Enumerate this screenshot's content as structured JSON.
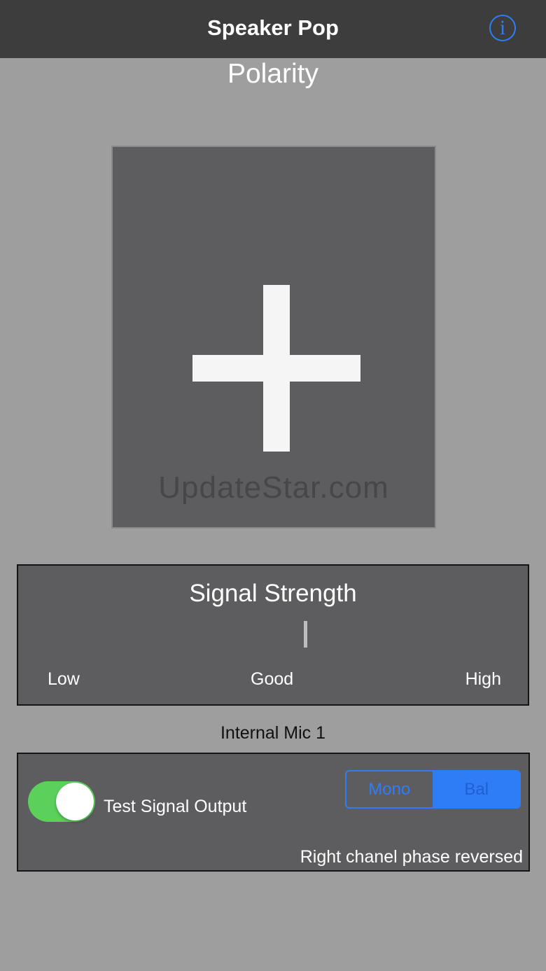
{
  "nav": {
    "title": "Speaker Pop",
    "info_icon": "info-icon",
    "info_glyph": "i"
  },
  "polarity": {
    "title": "Polarity",
    "symbol": "plus-icon"
  },
  "watermark": {
    "text": "UpdateStar.com"
  },
  "signal": {
    "title": "Signal Strength",
    "scale": [
      "Low",
      "Good",
      "High"
    ],
    "level_percent": 56
  },
  "input": {
    "source": "Internal Mic 1"
  },
  "output": {
    "toggle_label": "Test Signal Output",
    "toggle_on": true,
    "segments": [
      "Mono",
      "Bal"
    ],
    "selected_segment": "Bal",
    "status": "Right chanel phase reversed"
  },
  "colors": {
    "accent": "#2f7df6",
    "toggle_on": "#5bd15c",
    "panel": "#5d5d5f",
    "background": "#9e9e9e",
    "navbar": "#3d3d3d"
  }
}
